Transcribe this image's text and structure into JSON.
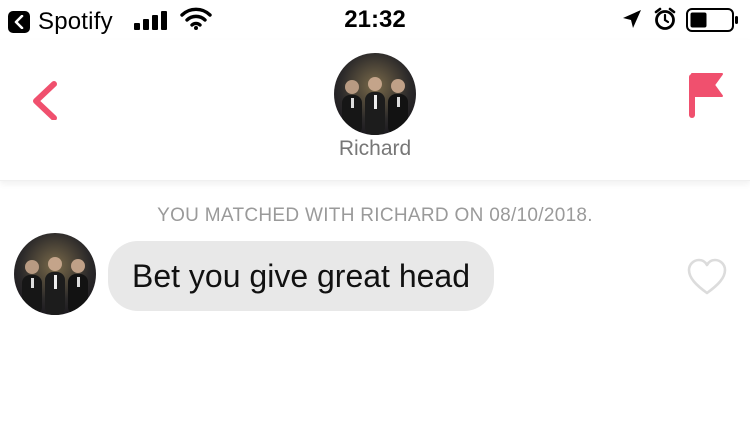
{
  "status_bar": {
    "back_app_label": "Spotify",
    "time": "21:32",
    "icons": [
      "chevron-left-icon",
      "signal-icon",
      "wifi-icon",
      "location-arrow-icon",
      "alarm-icon",
      "battery-icon"
    ]
  },
  "header": {
    "name": "Richard",
    "accent_color": "#f0506e",
    "icons": [
      "back-chevron-icon",
      "flag-icon"
    ]
  },
  "conversation": {
    "match_notice": "YOU MATCHED WITH RICHARD ON 08/10/2018.",
    "messages": [
      {
        "text": "Bet you give great head"
      }
    ],
    "icons": [
      "heart-outline-icon"
    ]
  }
}
